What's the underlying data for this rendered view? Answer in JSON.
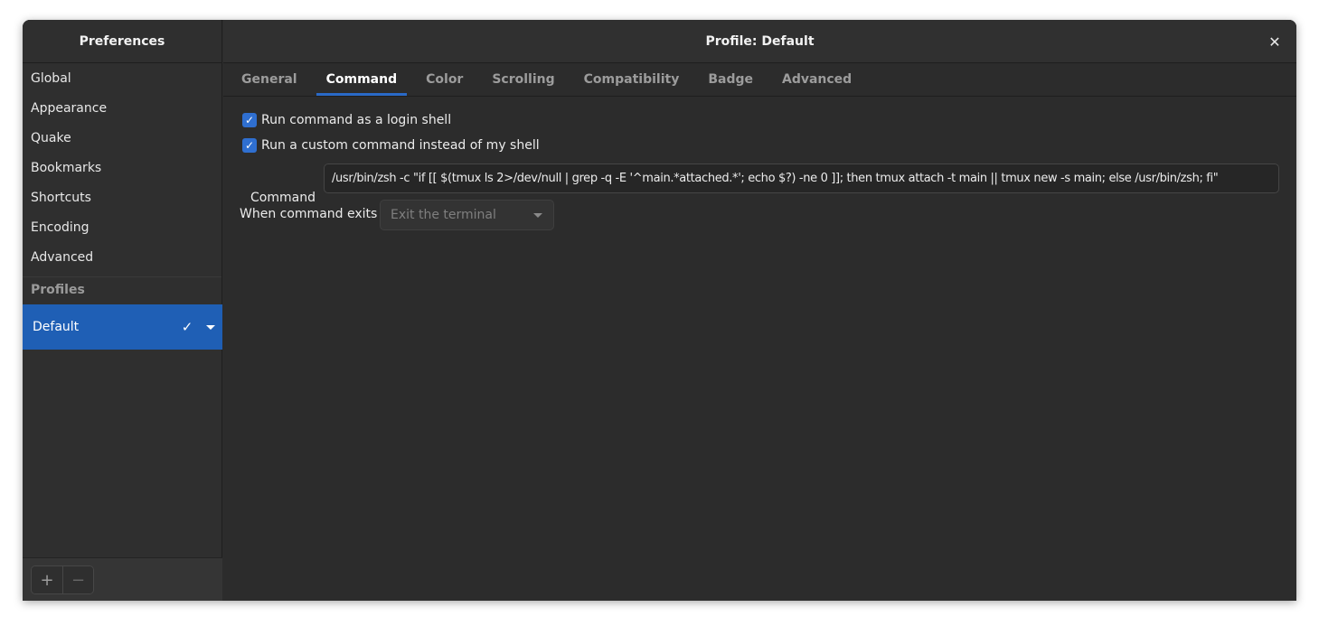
{
  "sidebar": {
    "title": "Preferences",
    "items": [
      {
        "label": "Global"
      },
      {
        "label": "Appearance"
      },
      {
        "label": "Quake"
      },
      {
        "label": "Bookmarks"
      },
      {
        "label": "Shortcuts"
      },
      {
        "label": "Encoding"
      },
      {
        "label": "Advanced"
      }
    ],
    "profiles_heading": "Profiles",
    "profile": {
      "label": "Default",
      "check_icon": "checkmark-icon",
      "menu_icon": "chevron-down-icon"
    },
    "footer": {
      "add": "+",
      "remove": "−"
    }
  },
  "main": {
    "title": "Profile: Default",
    "close_icon": "close-icon",
    "tabs": [
      {
        "label": "General"
      },
      {
        "label": "Command"
      },
      {
        "label": "Color"
      },
      {
        "label": "Scrolling"
      },
      {
        "label": "Compatibility"
      },
      {
        "label": "Badge"
      },
      {
        "label": "Advanced"
      }
    ],
    "active_tab": "Command",
    "login_shell": {
      "label": "Run command as a login shell",
      "checked": true
    },
    "custom_command": {
      "label": "Run a custom command instead of my shell",
      "checked": true
    },
    "command": {
      "label": "Command",
      "value": "/usr/bin/zsh -c \"if [[ $(tmux ls 2>/dev/null | grep -q -E '^main.*attached.*'; echo $?) -ne 0 ]]; then tmux attach -t main || tmux new -s main; else /usr/bin/zsh; fi\""
    },
    "on_exit": {
      "label": "When command exits",
      "value": "Exit the terminal"
    }
  },
  "colors": {
    "accent": "#1f5fb5",
    "tab_underline": "#2a6ac7",
    "window_bg": "#2c2c2c"
  }
}
